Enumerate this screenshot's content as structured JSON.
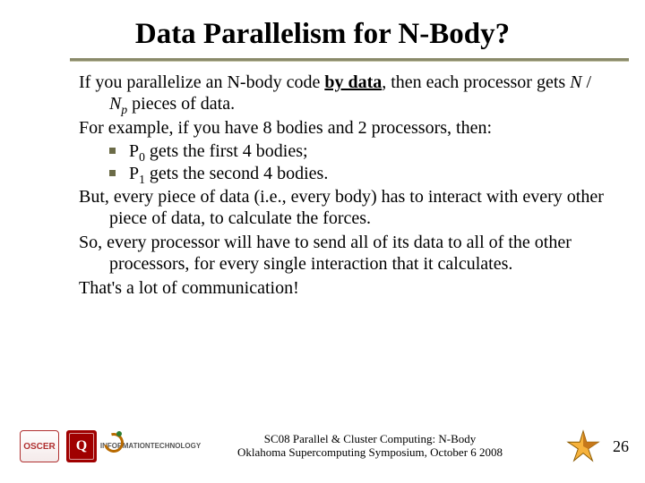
{
  "title": "Data Parallelism for N-Body?",
  "p1_a": "If you parallelize an N-body code ",
  "p1_b": "by data",
  "p1_c": ", then each processor gets ",
  "p1_d": "N",
  "p1_e": " / ",
  "p1_f": "N",
  "p1_g": "p",
  "p1_h": " pieces of data.",
  "p2": "For example, if you have 8 bodies and 2 processors, then:",
  "b1_a": "P",
  "b1_b": "0",
  "b1_c": " gets the first 4 bodies;",
  "b2_a": "P",
  "b2_b": "1",
  "b2_c": " gets the second 4 bodies.",
  "p3": "But, every piece of data (i.e., every body) has to interact with every other piece of data, to calculate the forces.",
  "p4": "So, every processor will have to send all of its data to all of the other processors, for every single interaction that it calculates.",
  "p5": "That's a lot of communication!",
  "footer": {
    "line1": "SC08 Parallel & Cluster Computing: N-Body",
    "line2": "Oklahoma Supercomputing Symposium, October 6 2008"
  },
  "logos": {
    "oscer": "OSCER",
    "ou": "Q",
    "it1": "INFORMATION",
    "it2": "TECHNOLOGY"
  },
  "page_number": "26"
}
